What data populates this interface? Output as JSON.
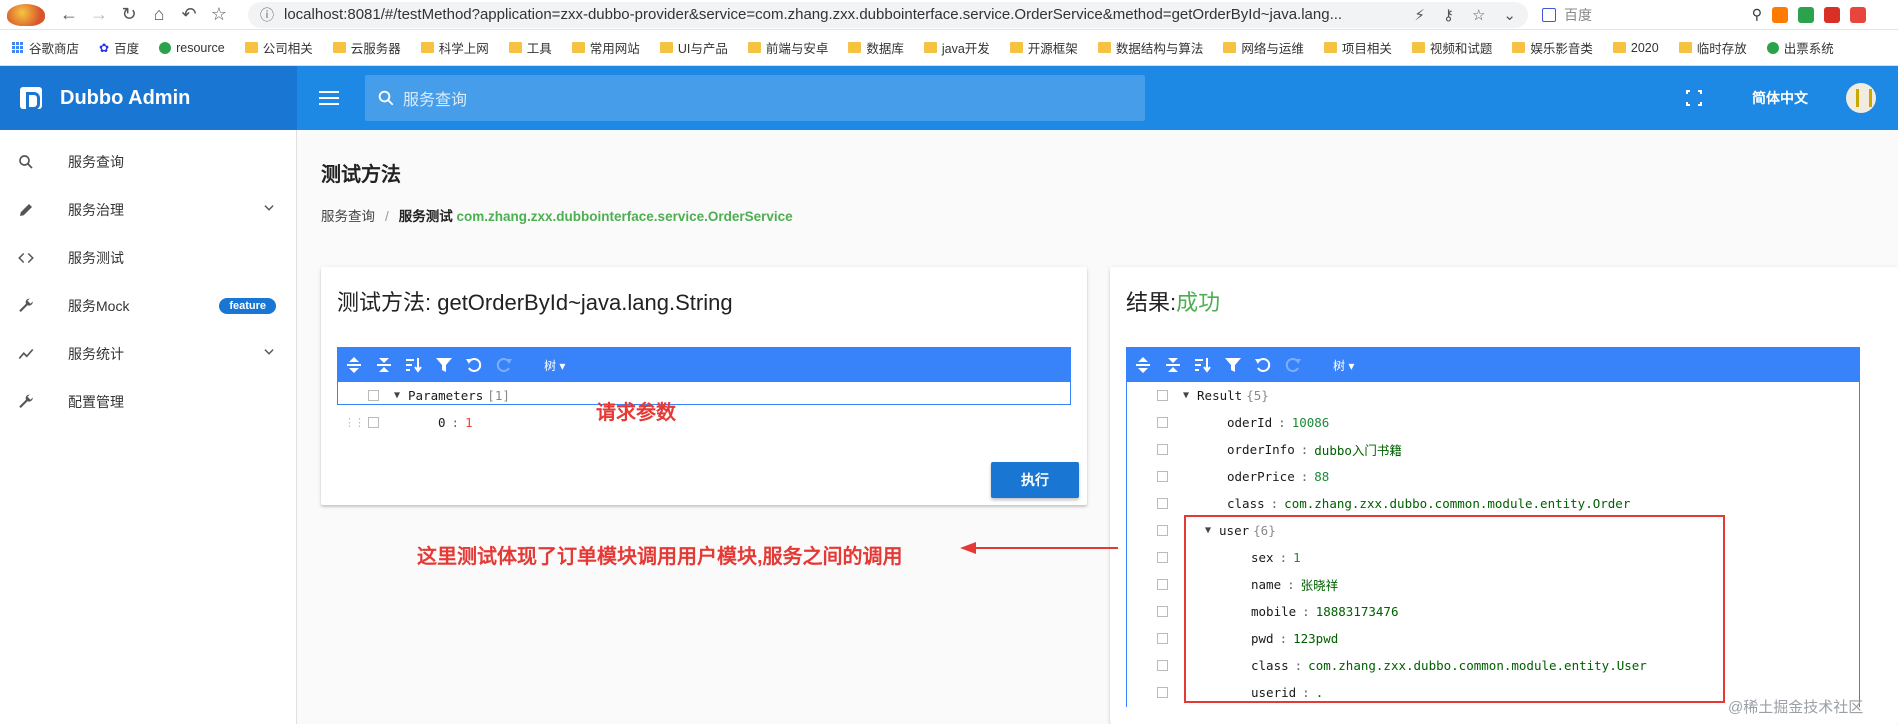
{
  "browser": {
    "url": "localhost:8081/#/testMethod?application=zxx-dubbo-provider&service=com.zhang.zxx.dubbointerface.service.OrderService&method=getOrderById~java.lang...",
    "search_placeholder": "百度",
    "bookmarks": [
      "谷歌商店",
      "百度",
      "resource",
      "公司相关",
      "云服务器",
      "科学上网",
      "工具",
      "常用网站",
      "UI与产品",
      "前端与安卓",
      "数据库",
      "java开发",
      "开源框架",
      "数据结构与算法",
      "网络与运维",
      "项目相关",
      "视频和试题",
      "娱乐影音类",
      "2020",
      "临时存放",
      "出票系统"
    ]
  },
  "header": {
    "brand": "Dubbo Admin",
    "search_placeholder": "服务查询",
    "language": "简体中文"
  },
  "sidebar": {
    "items": [
      {
        "label": "服务查询",
        "icon": "search-icon"
      },
      {
        "label": "服务治理",
        "icon": "pencil-icon",
        "expandable": true
      },
      {
        "label": "服务测试",
        "icon": "code-icon"
      },
      {
        "label": "服务Mock",
        "icon": "wrench-icon",
        "badge": "feature"
      },
      {
        "label": "服务统计",
        "icon": "trend-icon",
        "expandable": true
      },
      {
        "label": "配置管理",
        "icon": "wrench-icon"
      }
    ]
  },
  "page": {
    "title": "测试方法",
    "breadcrumb": {
      "home": "服务查询",
      "current_label": "服务测试",
      "service": "com.zhang.zxx.dubbointerface.service.OrderService"
    }
  },
  "left_card": {
    "title": "测试方法: getOrderById~java.lang.String",
    "mode": "树",
    "params_key": "Parameters",
    "params_meta": "[1]",
    "param_index": "0",
    "param_value": "1",
    "execute_label": "执行"
  },
  "right_card": {
    "title_prefix": "结果:",
    "title_status": "成功",
    "mode": "树",
    "result_key": "Result",
    "result_meta": "{5}",
    "fields": {
      "oderId": "10086",
      "orderInfo": "dubbo入门书籍",
      "oderPrice": "88",
      "class": "com.zhang.zxx.dubbo.common.module.entity.Order"
    },
    "user_key": "user",
    "user_meta": "{6}",
    "user_fields": {
      "sex": "1",
      "name": "张晓祥",
      "mobile": "18883173476",
      "pwd": "123pwd",
      "class": "com.zhang.zxx.dubbo.common.module.entity.User",
      "userid_key": "userid",
      "userid_value": "."
    }
  },
  "annotations": {
    "params_note": "请求参数",
    "call_note": "这里测试体现了订单模块调用用户模块,服务之间的调用",
    "color": "#e53935"
  },
  "watermark": "@稀土掘金技术社区",
  "colors": {
    "header": "#1e88e5",
    "brand": "#1976d2",
    "editor": "#3883fa",
    "success": "#4caf50"
  }
}
